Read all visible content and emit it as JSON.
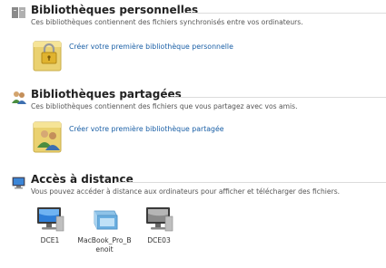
{
  "personal": {
    "title": "Bibliothèques personnelles",
    "description": "Ces bibliothèques contiennent des fichiers synchronisés entre vos ordinateurs.",
    "action_label": "Créer votre première bibliothèque personnelle",
    "icon": "library-lock-icon"
  },
  "shared": {
    "title": "Bibliothèques partagées",
    "description": "Ces bibliothèques contiennent des fichiers que vous partagez avec vos amis.",
    "action_label": "Créer votre première bibliothèque partagée",
    "icon": "shared-users-icon"
  },
  "remote": {
    "title": "Accès à distance",
    "description": "Vous pouvez accéder à distance aux ordinateurs pour afficher et télécharger des fichiers.",
    "icon": "remote-computer-icon",
    "computers": [
      {
        "name": "DCE1",
        "icon": "monitor-icon"
      },
      {
        "name": "MacBook_Pro_Benoit",
        "icon": "macbook-icon"
      },
      {
        "name": "DCE03",
        "icon": "monitor-icon"
      }
    ]
  },
  "colors": {
    "link": "#1a5fa6",
    "title": "#222222",
    "description": "#555555",
    "folder": "#f1dd78"
  }
}
